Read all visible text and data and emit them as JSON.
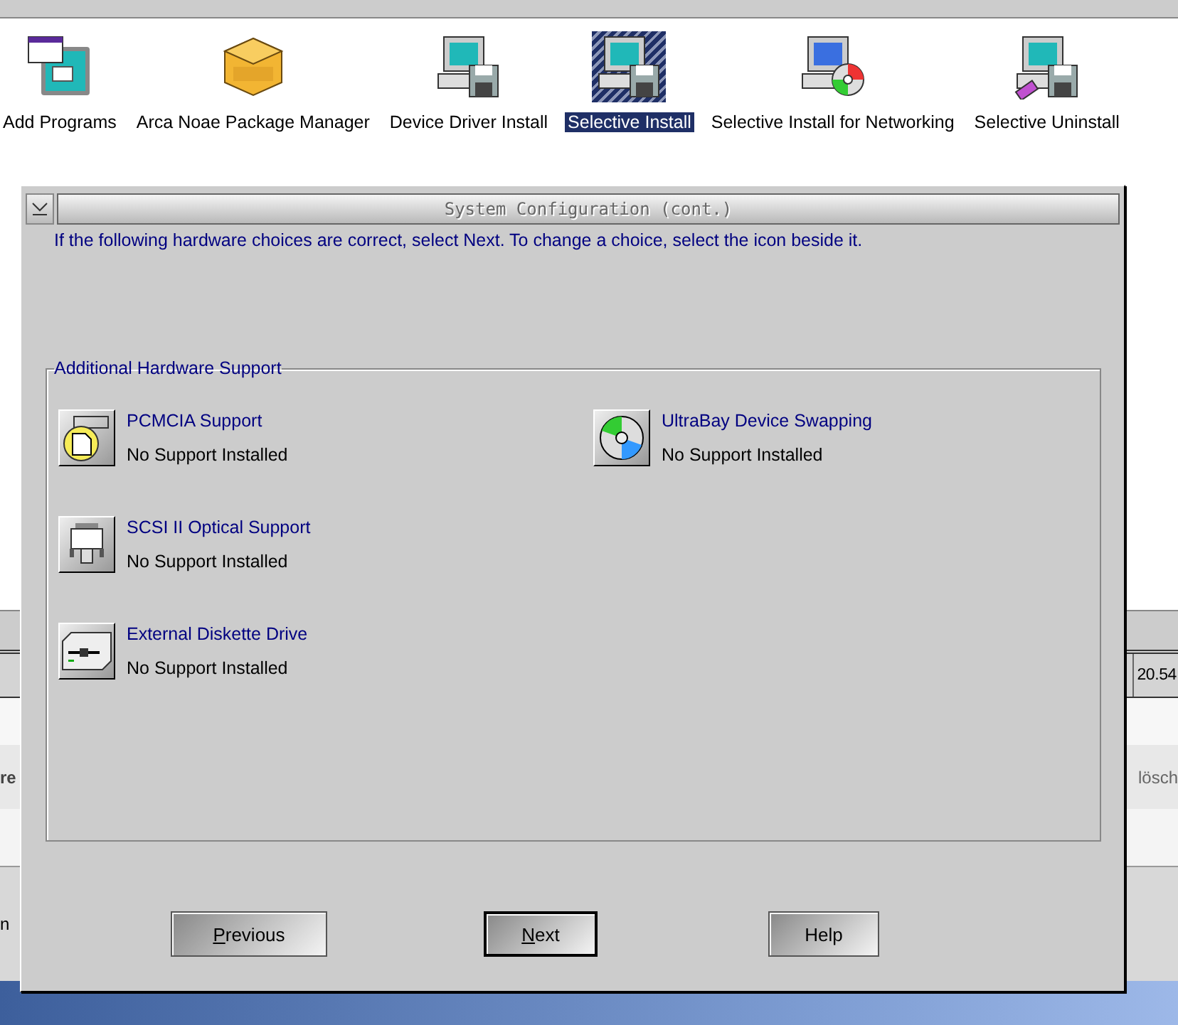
{
  "folder": {
    "items": [
      {
        "label": "Add Programs",
        "kind": "windows",
        "selected": false
      },
      {
        "label": "Arca Noae Package Manager",
        "kind": "yum",
        "selected": false
      },
      {
        "label": "Device Driver Install",
        "kind": "computer",
        "selected": false
      },
      {
        "label": "Selective Install",
        "kind": "computer",
        "selected": true
      },
      {
        "label": "Selective Install for Networking",
        "kind": "cd-computer",
        "selected": false
      },
      {
        "label": "Selective Uninstall",
        "kind": "eraser-computer",
        "selected": false
      }
    ]
  },
  "background": {
    "clock": "20.54",
    "fragment_left": "re",
    "fragment_right": "lösch",
    "fragment_bottom": "n"
  },
  "dialog": {
    "title": "System Configuration (cont.)",
    "instructions": "If the following hardware choices are correct, select Next. To change a choice, select the icon beside it.",
    "group": {
      "title": "Additional Hardware Support",
      "columns": [
        [
          {
            "name": "PCMCIA Support",
            "status": "No Support Installed",
            "kind": "pcmcia"
          },
          {
            "name": "SCSI II Optical Support",
            "status": "No Support Installed",
            "kind": "scsi"
          },
          {
            "name": "External Diskette Drive",
            "status": "No Support Installed",
            "kind": "diskette"
          }
        ],
        [
          {
            "name": "UltraBay Device Swapping",
            "status": "No Support Installed",
            "kind": "cd"
          }
        ]
      ]
    },
    "buttons": [
      {
        "label": "Previous",
        "mnemonic": true,
        "default": false
      },
      {
        "label": "Next",
        "mnemonic": true,
        "default": true
      },
      {
        "label": "Help",
        "mnemonic": false,
        "default": false
      }
    ]
  }
}
